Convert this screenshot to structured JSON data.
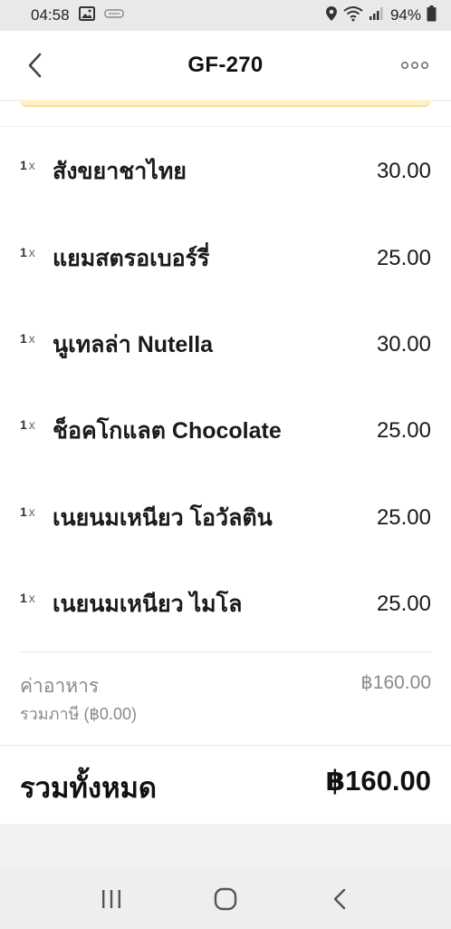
{
  "status_bar": {
    "time": "04:58",
    "battery": "94%",
    "icons": [
      "gallery-icon",
      "notification-icon",
      "location-icon",
      "wifi-icon",
      "signal-icon",
      "battery-icon"
    ]
  },
  "header": {
    "title": "GF-270",
    "back_icon": "chevron-left-icon",
    "more_icon": "more-dots-icon"
  },
  "order": {
    "items": [
      {
        "qty": "1",
        "x": "x",
        "name": "สังขยาชาไทย",
        "price": "30.00"
      },
      {
        "qty": "1",
        "x": "x",
        "name": "แยมสตรอเบอร์รี่",
        "price": "25.00"
      },
      {
        "qty": "1",
        "x": "x",
        "name": "นูเทลล่า Nutella",
        "price": "30.00"
      },
      {
        "qty": "1",
        "x": "x",
        "name": "ช็อคโกแลต Chocolate",
        "price": "25.00"
      },
      {
        "qty": "1",
        "x": "x",
        "name": "เนยนมเหนียว โอวัลติน",
        "price": "25.00"
      },
      {
        "qty": "1",
        "x": "x",
        "name": "เนยนมเหนียว ไมโล",
        "price": "25.00"
      }
    ]
  },
  "summary": {
    "food_label": "ค่าอาหาร",
    "food_price": "฿160.00",
    "tax_label": "รวมภาษี (฿0.00)",
    "total_label": "รวมทั้งหมด",
    "total_value": "฿160.00"
  },
  "nav_bar": {
    "icons": [
      "recent-apps-icon",
      "home-icon",
      "back-icon"
    ]
  },
  "colors": {
    "accent_strip": "#fdf2cc",
    "muted_text": "#8a8a8a"
  }
}
